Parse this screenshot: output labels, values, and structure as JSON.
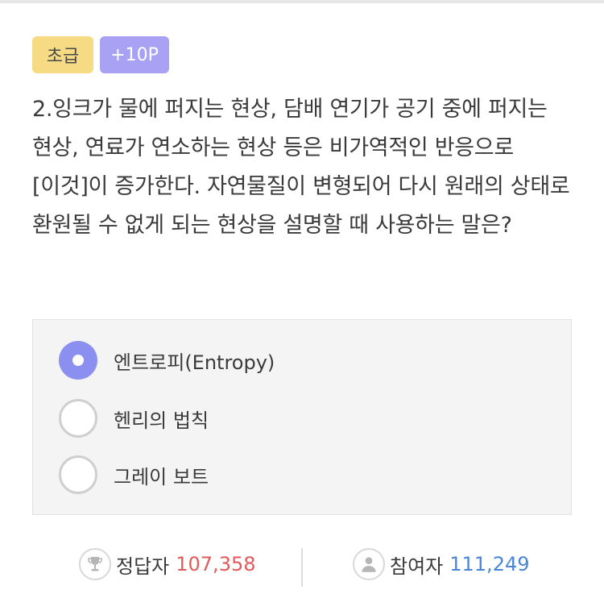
{
  "badges": {
    "level": "초급",
    "points": "+10P"
  },
  "question": {
    "text": "2.잉크가 물에 퍼지는 현상, 담배 연기가 공기 중에 퍼지는 현상, 연료가 연소하는 현상 등은 비가역적인 반응으로 [이것]이 증가한다. 자연물질이 변형되어 다시 원래의 상태로 환원될 수 없게 되는 현상을 설명할 때 사용하는 말은?"
  },
  "options": [
    {
      "label": "엔트로피(Entropy)",
      "selected": true
    },
    {
      "label": "헨리의 법칙",
      "selected": false
    },
    {
      "label": "그레이 보트",
      "selected": false
    }
  ],
  "stats": {
    "correct_label": "정답자",
    "correct_value": "107,358",
    "participants_label": "참여자",
    "participants_value": "111,249",
    "correct_icon": "trophy-icon",
    "participants_icon": "person-icon"
  },
  "colors": {
    "level_badge": "#f7da84",
    "points_badge": "#a9a2f4",
    "selected_radio": "#8b8ff0",
    "correct_number": "#e25a5a",
    "participants_number": "#4b86d6"
  }
}
